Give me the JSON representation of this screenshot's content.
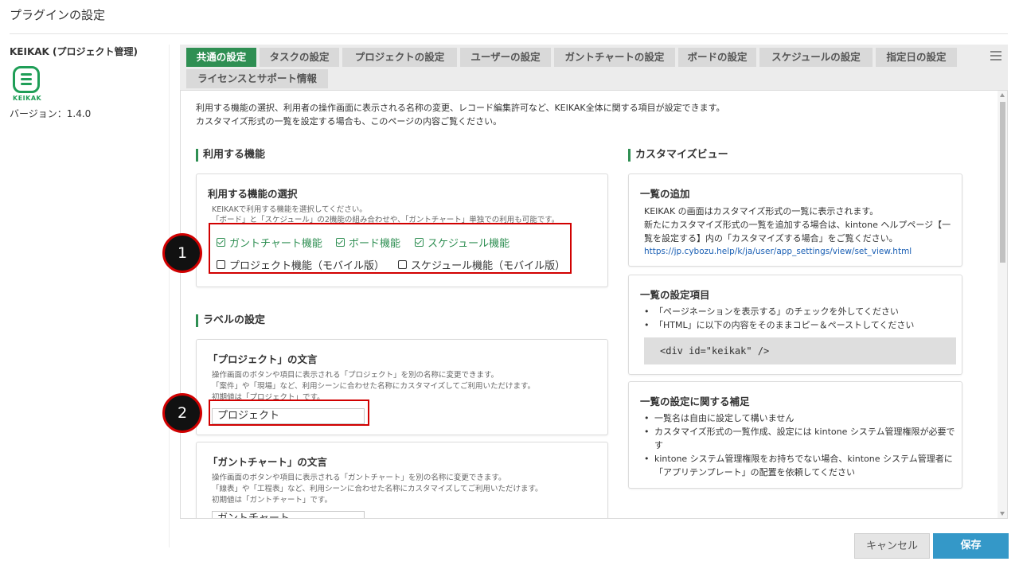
{
  "page_title": "プラグインの設定",
  "plugin": {
    "name": "KEIKAK (プロジェクト管理)",
    "logo_text": "KEIKAK",
    "version": "バージョン：1.4.0"
  },
  "tabs": [
    {
      "label": "共通の設定",
      "active": true
    },
    {
      "label": "タスクの設定"
    },
    {
      "label": "プロジェクトの設定"
    },
    {
      "label": "ユーザーの設定"
    },
    {
      "label": "ガントチャートの設定"
    },
    {
      "label": "ボードの設定"
    },
    {
      "label": "スケジュールの設定"
    },
    {
      "label": "指定日の設定"
    },
    {
      "label": "ライセンスとサポート情報"
    }
  ],
  "intro": {
    "line1": "利用する機能の選択、利用者の操作画面に表示される名称の変更、レコード編集許可など、KEIKAK全体に関する項目が設定できます。",
    "line2": "カスタマイズ形式の一覧を設定する場合も、このページの内容ご覧ください。"
  },
  "features": {
    "heading": "利用する機能",
    "card_title": "利用する機能の選択",
    "note1": "KEIKAKで利用する機能を選択してください。",
    "note2": "「ボード」と「スケジュール」の2機能の組み合わせや、「ガントチャート」単独での利用も可能です。",
    "options": [
      {
        "label": "ガントチャート機能",
        "checked": true
      },
      {
        "label": "ボード機能",
        "checked": true
      },
      {
        "label": "スケジュール機能",
        "checked": true
      },
      {
        "label": "プロジェクト機能（モバイル版）",
        "checked": false
      },
      {
        "label": "スケジュール機能（モバイル版）",
        "checked": false
      }
    ]
  },
  "labels": {
    "heading": "ラベルの設定",
    "project": {
      "title": "「プロジェクト」の文言",
      "note1": "操作画面のボタンや項目に表示される「プロジェクト」を別の名称に変更できます。",
      "note2": "「案件」や「現場」など、利用シーンに合わせた名称にカスタマイズしてご利用いただけます。",
      "note3": "初期値は「プロジェクト」です。",
      "value": "プロジェクト"
    },
    "gantt": {
      "title": "「ガントチャート」の文言",
      "note1": "操作画面のボタンや項目に表示される「ガントチャート」を別の名称に変更できます。",
      "note2": "「線表」や「工程表」など、利用シーンに合わせた名称にカスタマイズしてご利用いただけます。",
      "note3": "初期値は「ガントチャート」です。",
      "value": "ガントチャート"
    }
  },
  "custom_view": {
    "heading": "カスタマイズビュー",
    "add": {
      "title": "一覧の追加",
      "line1": "KEIKAK の画面はカスタマイズ形式の一覧に表示されます。",
      "line2": "新たにカスタマイズ形式の一覧を追加する場合は、kintone ヘルプページ【一",
      "line3": "覧を設定する】内の「カスタマイズする場合」をご覧ください。",
      "link": "https://jp.cybozu.help/k/ja/user/app_settings/view/set_view.html"
    },
    "settings": {
      "title": "一覧の設定項目",
      "bullet1": "「ページネーションを表示する」のチェックを外してください",
      "bullet2": "「HTML」に以下の内容をそのままコピー＆ペーストしてください",
      "code": "<div id=\"keikak\" />"
    },
    "supplement": {
      "title": "一覧の設定に関する補足",
      "bullet1": "一覧名は自由に設定して構いません",
      "bullet2a": "カスタマイズ形式の一覧作成、設定には kintone システム管理権限が必要で",
      "bullet2b": "す",
      "bullet3a": "kintone システム管理権限をお持ちでない場合、kintone システム管理者に",
      "bullet3b": "「アプリテンプレート」の配置を依頼してください"
    }
  },
  "markers": [
    "1",
    "2"
  ],
  "buttons": {
    "cancel": "キャンセル",
    "save": "保存"
  },
  "colors": {
    "accent_green": "#2f8f53",
    "save_blue": "#3498c8",
    "annotation_red": "#d10000"
  }
}
